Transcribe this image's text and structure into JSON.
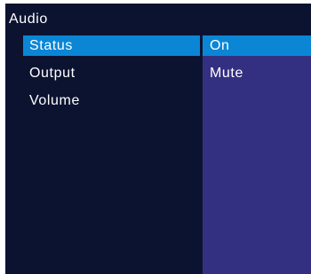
{
  "menu": {
    "title": "Audio",
    "items": [
      {
        "label": "Status",
        "value": "On",
        "selected": true
      },
      {
        "label": "Output",
        "value": "Mute",
        "selected": false
      },
      {
        "label": "Volume",
        "value": "",
        "selected": false
      }
    ]
  },
  "colors": {
    "screen_background": "#0c1331",
    "selection_highlight": "#0b86d5",
    "value_panel": "#343081",
    "text": "#ffffff"
  }
}
